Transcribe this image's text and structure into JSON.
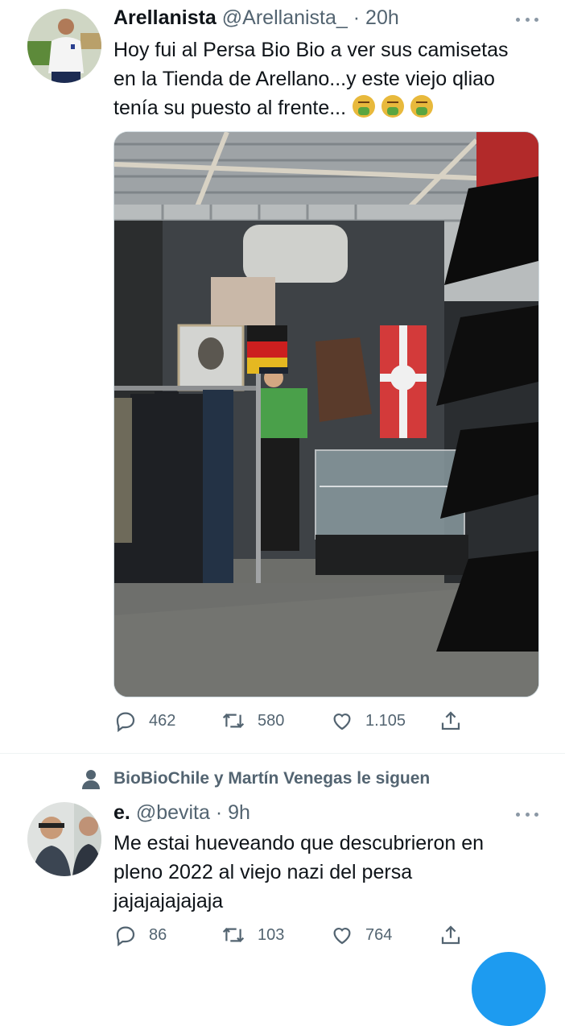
{
  "tweet1": {
    "name": "Arellanista",
    "handle": "@Arellanista_",
    "time": "· 20h",
    "text_line1": "Hoy fui al Persa Bio Bio a ver sus camisetas",
    "text_line2": "en la Tienda de Arellano...y este viejo qliao",
    "text_line3": "tenía su puesto al frente...",
    "emojis": [
      "nauseated-face",
      "nauseated-face",
      "nauseated-face"
    ],
    "replies": "462",
    "retweets": "580",
    "likes": "1.105"
  },
  "social_context": {
    "text": "BioBioChile y Martín Venegas le siguen"
  },
  "tweet2": {
    "name": "e.",
    "handle": "@bevita",
    "time": "· 9h",
    "text_line1": "Me estai hueveando que descubrieron en",
    "text_line2": "pleno 2022 al viejo nazi del persa",
    "text_line3": "jajajajajajaja",
    "replies": "86",
    "retweets": "103",
    "likes": "764"
  },
  "colors": {
    "accent": "#1d9bf0",
    "secondary_text": "#536471",
    "primary_text": "#0f1419"
  }
}
